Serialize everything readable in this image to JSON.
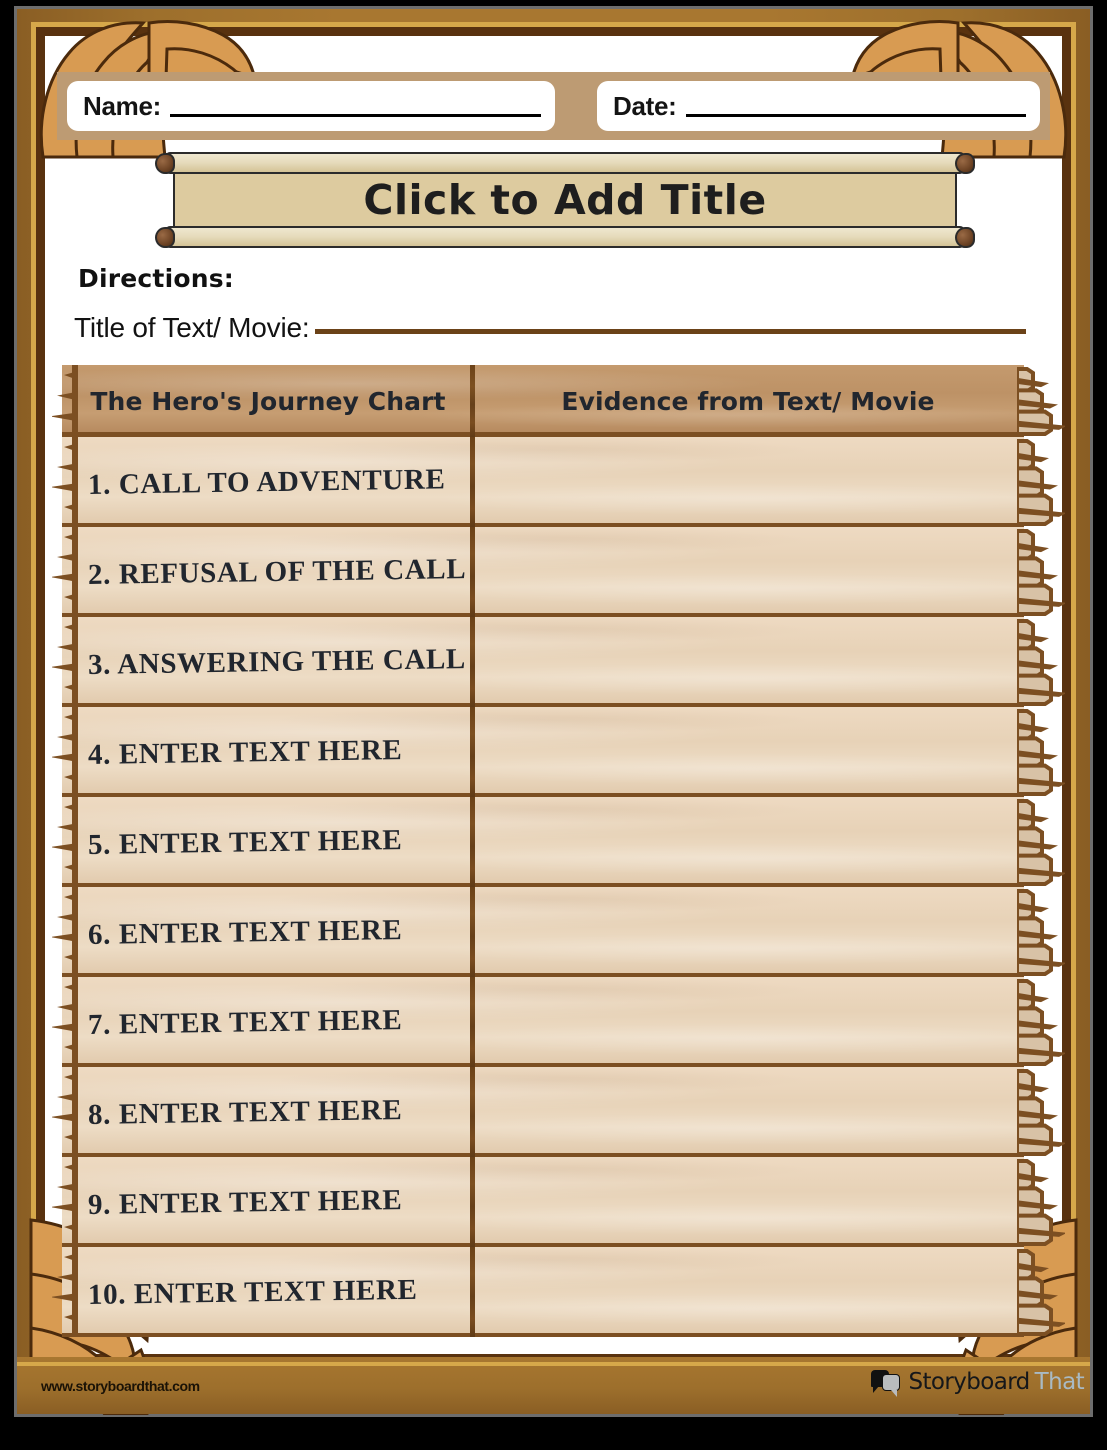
{
  "header": {
    "name_label": "Name:",
    "date_label": "Date:"
  },
  "title_scroll": {
    "title": "Click to Add Title"
  },
  "instructions": {
    "directions_label": "Directions:",
    "title_of_text_label": "Title of Text/ Movie:"
  },
  "table": {
    "columns": [
      "The Hero's Journey Chart",
      "Evidence from Text/ Movie"
    ],
    "rows": [
      {
        "step": "1. CALL TO ADVENTURE",
        "evidence": ""
      },
      {
        "step": "2. REFUSAL OF THE CALL",
        "evidence": ""
      },
      {
        "step": "3. ANSWERING THE CALL",
        "evidence": ""
      },
      {
        "step": "4. ENTER TEXT HERE",
        "evidence": ""
      },
      {
        "step": "5. ENTER TEXT HERE",
        "evidence": ""
      },
      {
        "step": "6. ENTER TEXT HERE",
        "evidence": ""
      },
      {
        "step": "7. ENTER TEXT HERE",
        "evidence": ""
      },
      {
        "step": "8. ENTER TEXT HERE",
        "evidence": ""
      },
      {
        "step": "9. ENTER TEXT HERE",
        "evidence": ""
      },
      {
        "step": "10. ENTER TEXT HERE",
        "evidence": ""
      }
    ]
  },
  "footer": {
    "url": "www.storyboardthat.com",
    "logo_word1": "Storyboard",
    "logo_word2": "That"
  },
  "colors": {
    "frame_wood": "#a87730",
    "frame_gold": "#d6a84a",
    "frame_dark": "#59320f",
    "band_tan": "#bd9b73",
    "wood_header": "#bd9266",
    "wood_row": "#e7d2b7",
    "wood_line": "#7c4f22",
    "text_dark": "#21262e",
    "scroll_paper": "#ddcb9f"
  }
}
